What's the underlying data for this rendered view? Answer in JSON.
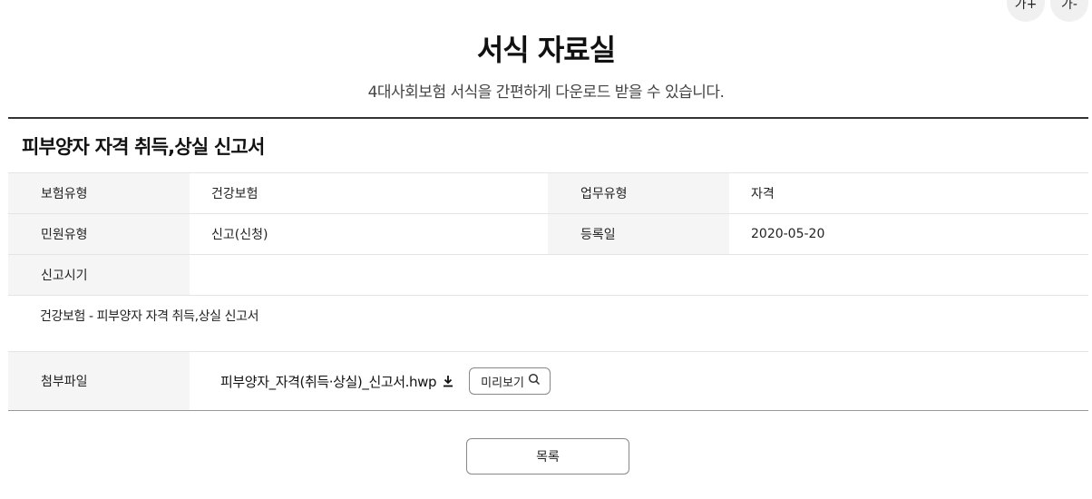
{
  "font_size_controls": {
    "increase_label": "가+",
    "decrease_label": "가-"
  },
  "header": {
    "title": "서식 자료실",
    "subtitle": "4대사회보험 서식을 간편하게 다운로드 받을 수 있습니다."
  },
  "document": {
    "title": "피부양자 자격 취득,상실 신고서",
    "fields": {
      "insurance_type": {
        "label": "보험유형",
        "value": "건강보험"
      },
      "work_type": {
        "label": "업무유형",
        "value": "자격"
      },
      "civil_type": {
        "label": "민원유형",
        "value": "신고(신청)"
      },
      "reg_date": {
        "label": "등록일",
        "value": "2020-05-20"
      },
      "report_period": {
        "label": "신고시기",
        "value": ""
      }
    },
    "description": "건강보험 - 피부양자 자격 취득,상실 신고서",
    "attachment": {
      "label": "첨부파일",
      "file_name": "피부양자_자격(취득·상실)_신고서.hwp",
      "preview_label": "미리보기"
    }
  },
  "footer": {
    "list_button_label": "목록"
  },
  "icons": {
    "download": "download-icon",
    "search": "search-icon"
  }
}
